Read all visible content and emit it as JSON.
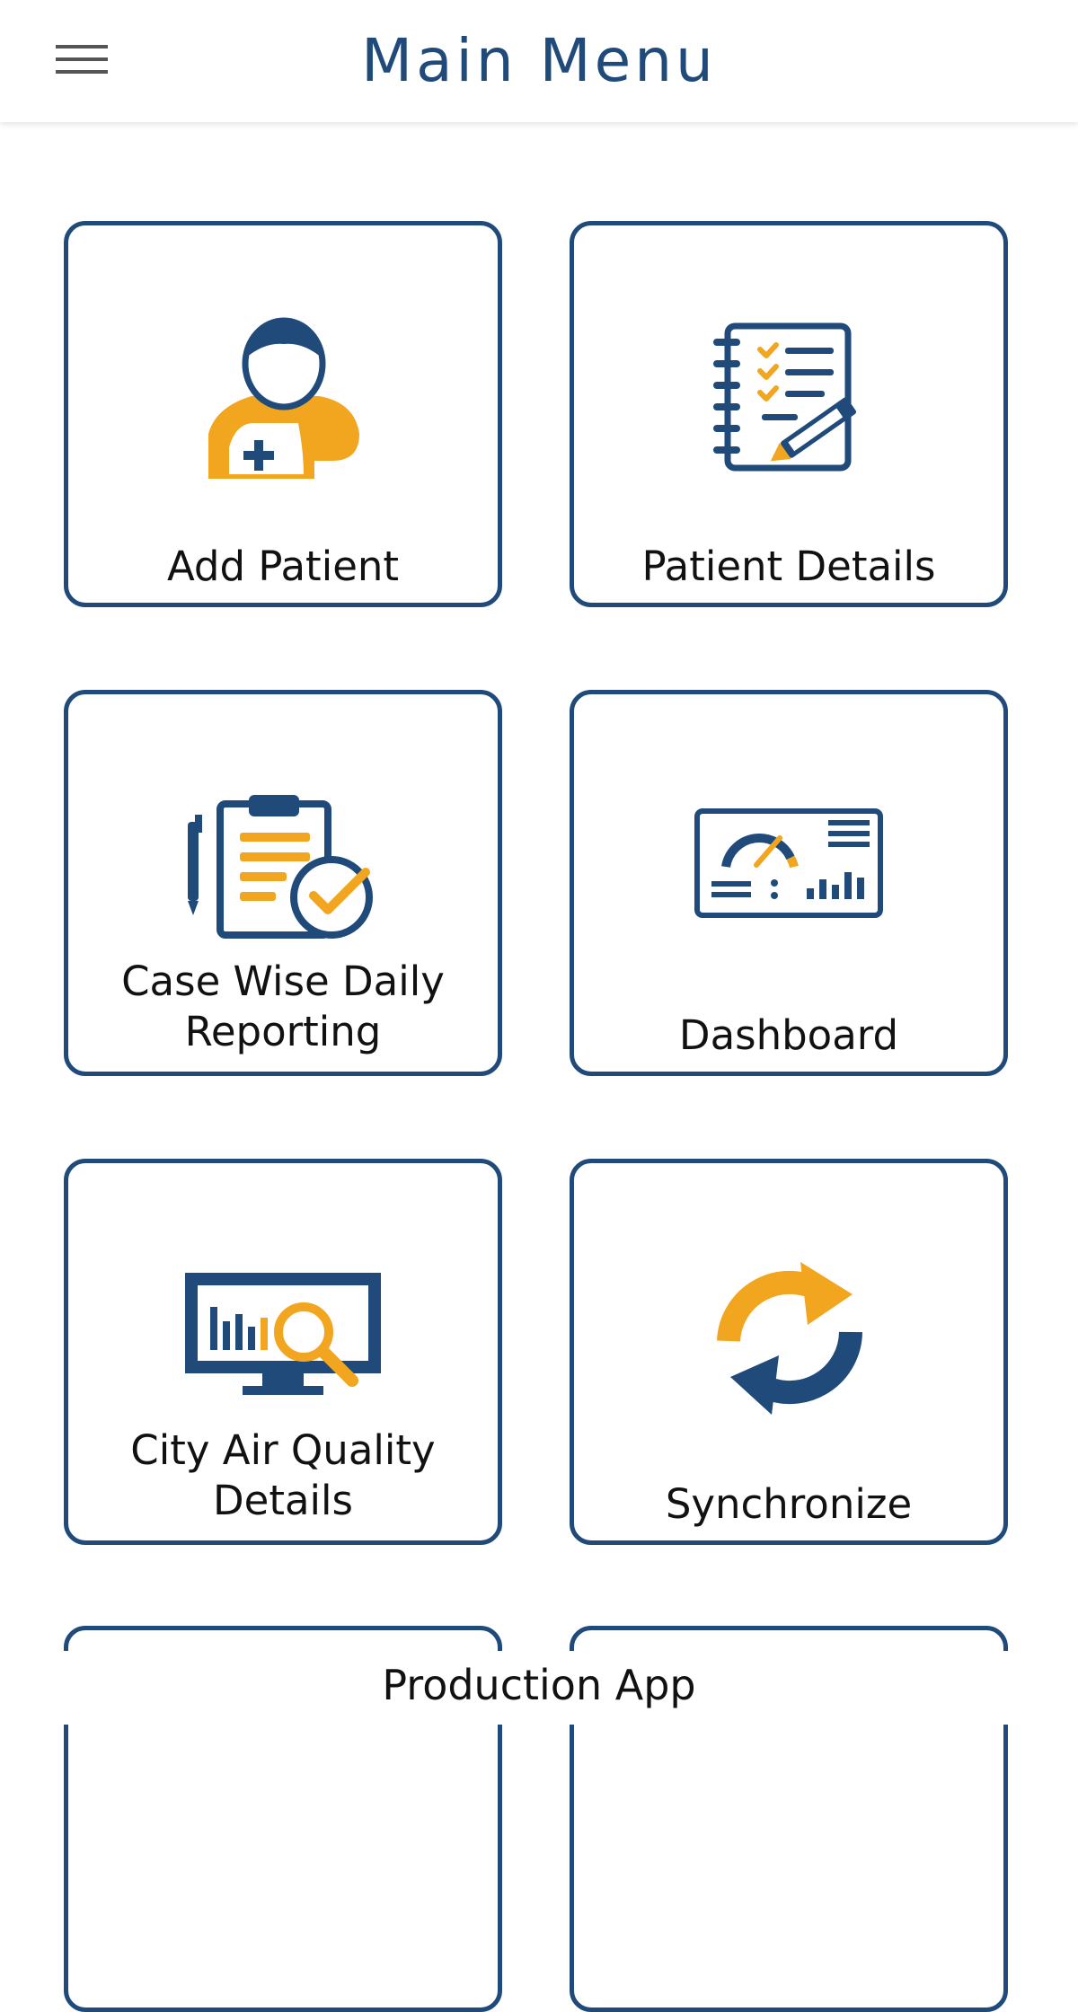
{
  "header": {
    "title": "Main Menu",
    "menu_icon": "hamburger-menu-icon"
  },
  "colors": {
    "navy": "#1f4a7a",
    "orange": "#f2a51f",
    "text": "#111111"
  },
  "tiles": [
    {
      "label": "Add Patient",
      "icon": "add-patient-icon"
    },
    {
      "label": "Patient Details",
      "icon": "notebook-checklist-icon"
    },
    {
      "label": "Case Wise Daily\nReporting",
      "icon": "clipboard-clock-icon"
    },
    {
      "label": "Dashboard",
      "icon": "dashboard-gauge-icon"
    },
    {
      "label": "City Air Quality\nDetails",
      "icon": "monitor-analytics-icon"
    },
    {
      "label": "Synchronize",
      "icon": "sync-arrows-icon"
    }
  ],
  "footer": {
    "label": "Production App"
  }
}
